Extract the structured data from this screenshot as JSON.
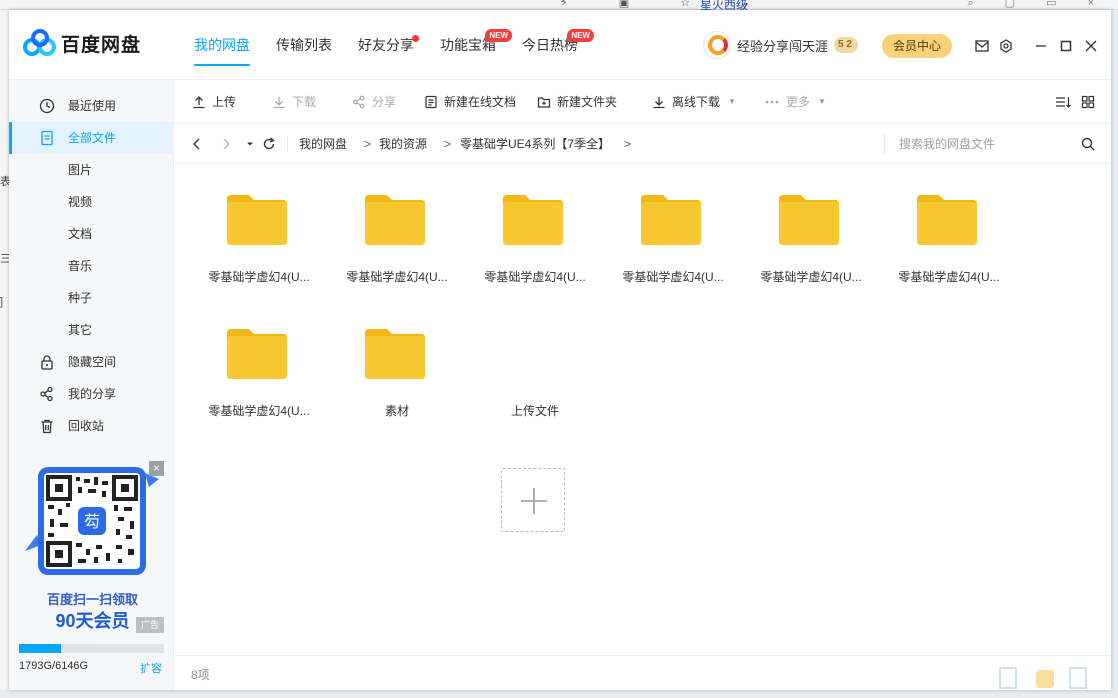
{
  "background": {
    "tab_title": "星火西级",
    "left_edge": [
      "表",
      "三",
      "]"
    ]
  },
  "app": {
    "logo_text": "百度网盘"
  },
  "nav": [
    {
      "label": "我的网盘",
      "active": true,
      "badge": null
    },
    {
      "label": "传输列表",
      "active": false,
      "badge": null
    },
    {
      "label": "好友分享",
      "active": false,
      "badge": "dot"
    },
    {
      "label": "功能宝箱",
      "active": false,
      "badge": "NEW"
    },
    {
      "label": "今日热榜",
      "active": false,
      "badge": "NEW"
    }
  ],
  "user": {
    "name": "经验分享闯天涯",
    "level": "5 2",
    "vip_button": "会员中心"
  },
  "sidebar": {
    "items": [
      {
        "label": "最近使用",
        "icon": "clock-icon"
      },
      {
        "label": "全部文件",
        "icon": "document-icon",
        "active": true
      },
      {
        "label": "图片"
      },
      {
        "label": "视频"
      },
      {
        "label": "文档"
      },
      {
        "label": "音乐"
      },
      {
        "label": "种子"
      },
      {
        "label": "其它"
      },
      {
        "label": "隐藏空间",
        "icon": "lock-icon"
      },
      {
        "label": "我的分享",
        "icon": "share-icon"
      },
      {
        "label": "回收站",
        "icon": "trash-icon"
      }
    ],
    "ad": {
      "line1": "百度扫一扫领取",
      "line2": "90天会员",
      "tag": "广告",
      "close": "×",
      "qr_center": "芶"
    },
    "storage": {
      "text": "1793G/6146G",
      "used_fraction": 0.29,
      "expand": "扩容"
    }
  },
  "toolbar": {
    "upload": "上传",
    "download": "下载",
    "share": "分享",
    "new_doc": "新建在线文档",
    "new_folder": "新建文件夹",
    "offline": "离线下载",
    "more": "更多"
  },
  "path": {
    "crumbs": [
      "我的网盘",
      "我的资源",
      "零基础学UE4系列【7季全】"
    ],
    "separator": ">",
    "search_placeholder": "搜索我的网盘文件"
  },
  "files": [
    {
      "name": "零基础学虚幻4(U...",
      "type": "folder"
    },
    {
      "name": "零基础学虚幻4(U...",
      "type": "folder"
    },
    {
      "name": "零基础学虚幻4(U...",
      "type": "folder"
    },
    {
      "name": "零基础学虚幻4(U...",
      "type": "folder"
    },
    {
      "name": "零基础学虚幻4(U...",
      "type": "folder"
    },
    {
      "name": "零基础学虚幻4(U...",
      "type": "folder"
    },
    {
      "name": "零基础学虚幻4(U...",
      "type": "folder"
    },
    {
      "name": "素材",
      "type": "folder"
    }
  ],
  "upload_tile": {
    "label": "上传文件"
  },
  "status": {
    "count": "8项"
  },
  "colors": {
    "accent": "#06a7ff",
    "folder": "#f8c830",
    "folder_tab": "#f0b816",
    "vip": "#f7d27b"
  }
}
